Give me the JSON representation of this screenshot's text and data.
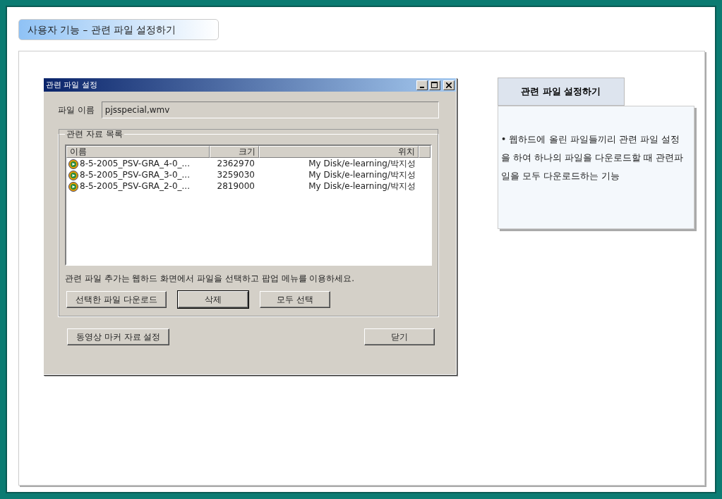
{
  "header": {
    "title": "사용자 기능 – 관련 파일 설정하기"
  },
  "dialog": {
    "title": "관련 파일 설정",
    "file_name": {
      "label": "파일 이름",
      "value": "pjsspecial,wmv"
    },
    "group": {
      "title": "관련 자료 목록",
      "columns": [
        "이름",
        "크기",
        "위치"
      ],
      "rows": [
        {
          "name": "8-5-2005_PSV-GRA_4-0_...",
          "size": "2362970",
          "location": "My Disk/e-learning/박지성"
        },
        {
          "name": "8-5-2005_PSV-GRA_3-0_...",
          "size": "3259030",
          "location": "My Disk/e-learning/박지성"
        },
        {
          "name": "8-5-2005_PSV-GRA_2-0_...",
          "size": "2819000",
          "location": "My Disk/e-learning/박지성"
        }
      ],
      "hint": "관련 파일 추가는 웹하드 화면에서 파일을 선택하고 팝업 메뉴를 이용하세요.",
      "buttons": [
        {
          "label": "선택한 파일 다운로드",
          "default": false
        },
        {
          "label": "삭제",
          "default": true
        },
        {
          "label": "모두 선택",
          "default": false
        }
      ]
    },
    "footer_buttons": [
      {
        "label": "동영상 마커 자료 설정"
      },
      {
        "label": "닫기"
      }
    ]
  },
  "note": {
    "title": "관련 파일 설정하기",
    "text": "• 웹하드에 올린 파일들끼리 관련 파일 설정을 하여 하나의 파일을 다운로드할 때 관련파일을 모두 다운로드하는 기능"
  }
}
